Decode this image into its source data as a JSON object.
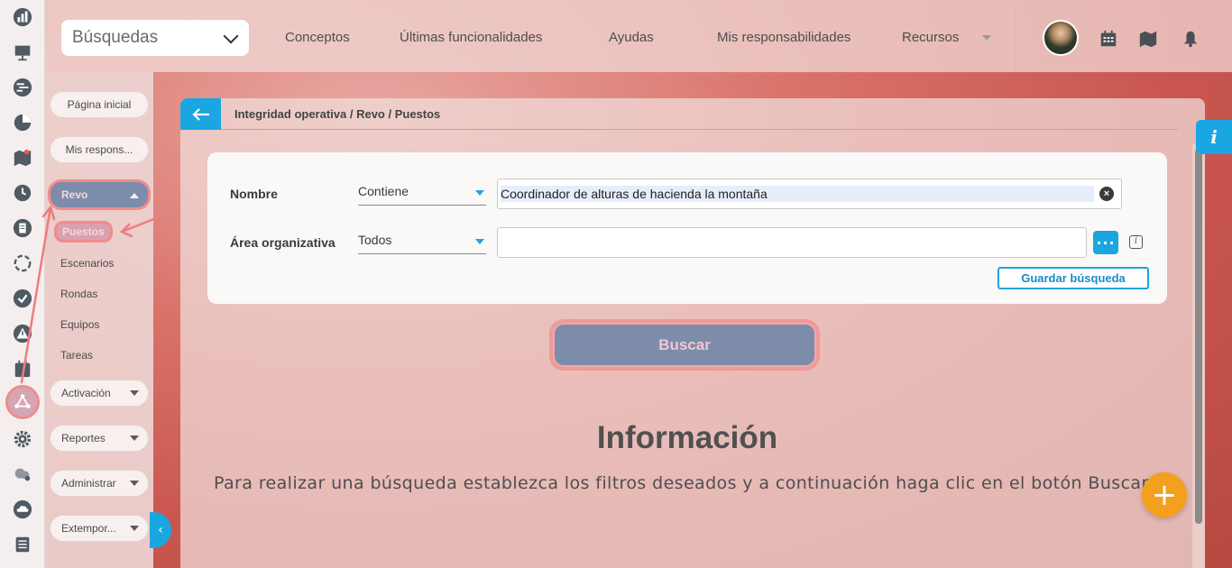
{
  "topbar": {
    "search_select": "Búsquedas",
    "nav": [
      "Conceptos",
      "Últimas funcionalidades",
      "Ayudas",
      "Mis responsabilidades",
      "Recursos"
    ]
  },
  "menu": {
    "home": "Página inicial",
    "responsibilities": "Mis respons...",
    "revo": "Revo",
    "revo_items": [
      "Puestos",
      "Escenarios",
      "Rondas",
      "Equipos",
      "Tareas"
    ],
    "groups": [
      "Activación",
      "Reportes",
      "Administrar",
      "Extempor..."
    ]
  },
  "breadcrumb": "Integridad operativa / Revo / Puestos",
  "filters": {
    "name_label": "Nombre",
    "name_operator": "Contiene",
    "name_value": "Coordinador de alturas de hacienda la montaña",
    "area_label": "Área organizativa",
    "area_operator": "Todos",
    "area_value": "",
    "save_search": "Guardar búsqueda"
  },
  "search_button": "Buscar",
  "info": {
    "title": "Información",
    "text": "Para realizar una búsqueda establezca los filtros deseados y a continuación haga clic en el botón Buscar"
  },
  "info_tab": "i",
  "fab": "+",
  "colors": {
    "accent": "#1aa6e0",
    "fab": "#f4a01f",
    "highlight": "#ef8c8c",
    "active_item": "#7e8cac"
  },
  "icons": {
    "rail": [
      "bar-chart-icon",
      "presentation-icon",
      "gantt-icon",
      "pie-chart-icon",
      "map-icon",
      "clock-icon",
      "document-icon",
      "cycle-icon",
      "check-icon",
      "warning-icon",
      "calendar-icon",
      "network-icon",
      "gear-icon",
      "cloud-gear-icon",
      "cloud-icon",
      "list-icon"
    ],
    "top": [
      "calendar-icon",
      "map-icon",
      "bell-icon"
    ]
  }
}
